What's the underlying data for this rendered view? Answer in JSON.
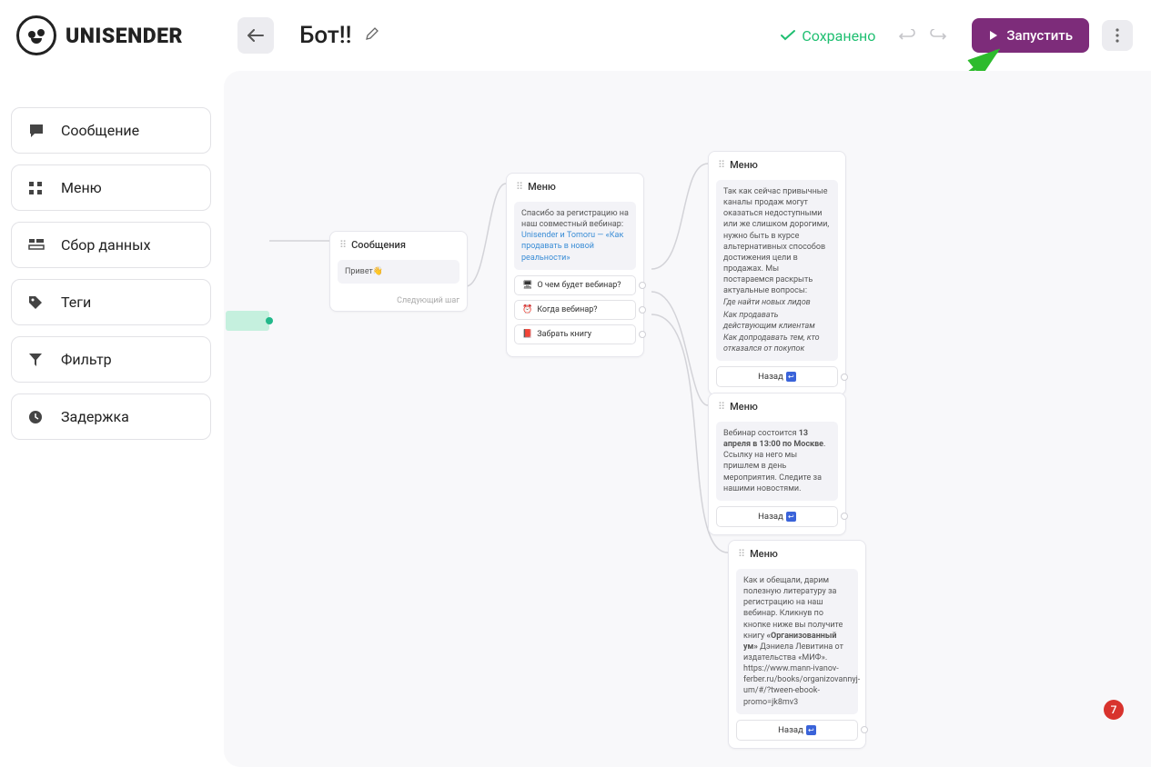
{
  "brand": "UNISENDER",
  "header": {
    "title": "Бот!!",
    "saved_label": "Сохранено",
    "launch_label": "Запустить"
  },
  "sidebar": {
    "items": [
      {
        "label": "Сообщение"
      },
      {
        "label": "Меню"
      },
      {
        "label": "Сбор данных"
      },
      {
        "label": "Теги"
      },
      {
        "label": "Фильтр"
      },
      {
        "label": "Задержка"
      }
    ]
  },
  "nodes": {
    "messages": {
      "title": "Сообщения",
      "greeting": "Привет👋",
      "next_step": "Следующий шаг"
    },
    "menu1": {
      "title": "Меню",
      "text_part1": "Спасибо за регистрацию на наш совместный вебинар: ",
      "link": "Unisender и Tomoru — «Как продавать в новой реальности»",
      "options": [
        {
          "icon": "🖥",
          "label": "О чем будет вебинар?"
        },
        {
          "icon": "⏰",
          "label": "Когда вебинар?"
        },
        {
          "icon": "📕",
          "label": "Забрать книгу"
        }
      ]
    },
    "menu2": {
      "title": "Меню",
      "intro": "Так как сейчас привычные каналы продаж могут оказаться недоступными или же слишком дорогими, нужно быть в курсе альтернативных способов достижения цели в продажах. Мы постараемся раскрыть актуальные вопросы:",
      "bullets": [
        "Где найти новых лидов",
        "Как продавать действующим клиентам",
        "Как допродавать тем, кто отказался от покупок"
      ],
      "back": "Назад"
    },
    "menu3": {
      "title": "Меню",
      "text_pre": "Вебинар состоится ",
      "bold": "13 апреля в 13:00 по Москве",
      "text_post": ". Ссылку на него мы пришлем в день мероприятия. Следите за нашими новостями.",
      "back": "Назад"
    },
    "menu4": {
      "title": "Меню",
      "text_pre": "Как и обещали, дарим полезную литературу за регистрацию на наш вебинар. Кликнув по кнопке ниже вы получите книгу ",
      "bold": "«Организованный ум»",
      "text_post": " Дэниела Левитина от издательства «МИФ». https://www.mann-ivanov-ferber.ru/books/organizovannyj-um/#/?tween-ebook-promo=jk8mv3",
      "back": "Назад"
    }
  },
  "badge": "7"
}
